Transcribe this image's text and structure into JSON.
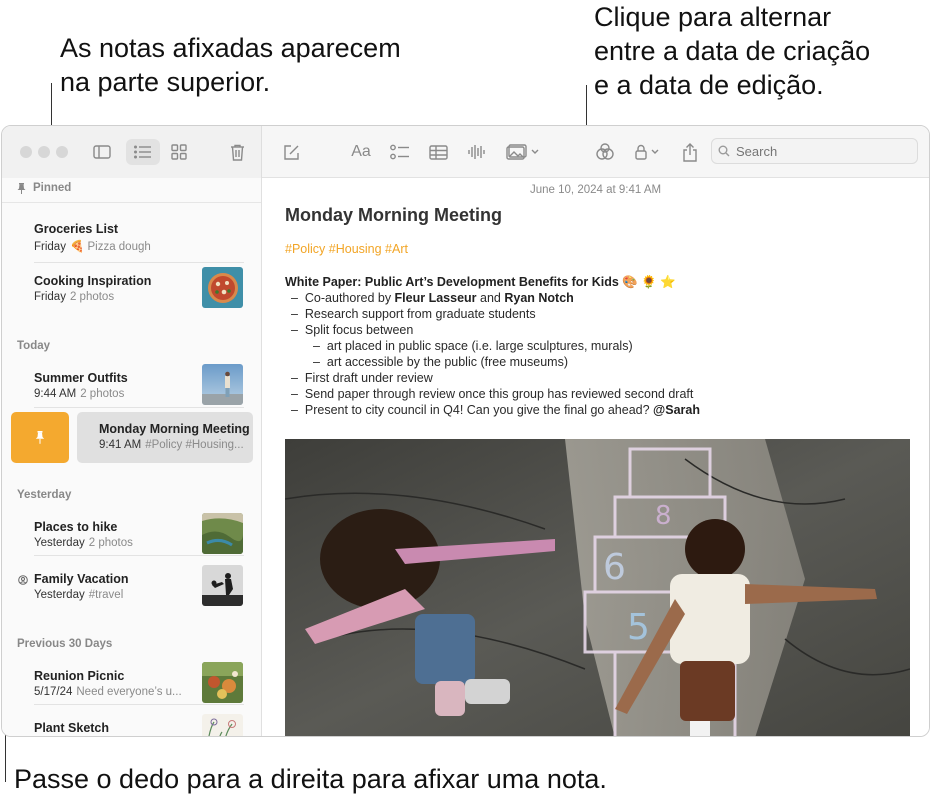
{
  "callouts": {
    "pinned_top": [
      "As notas afixadas aparecem",
      "na parte superior."
    ],
    "toggle_date": [
      "Clique para alternar",
      "entre a data de criação",
      "e a data de edição."
    ],
    "swipe_pin": "Passe o dedo para a direita para afixar uma nota."
  },
  "toolbar": {
    "format_label": "Aa",
    "search_placeholder": "Search"
  },
  "sidebar": {
    "sections": {
      "pinned": "Pinned",
      "today": "Today",
      "yesterday": "Yesterday",
      "previous": "Previous 30 Days"
    },
    "notes": [
      {
        "title": "Groceries List",
        "date": "Friday",
        "preview": "🍕 Pizza dough"
      },
      {
        "title": "Cooking Inspiration",
        "date": "Friday",
        "preview": "2 photos"
      },
      {
        "title": "Summer Outfits",
        "date": "9:44 AM",
        "preview": "2 photos"
      },
      {
        "title": "Monday Morning Meeting",
        "date": "9:41 AM",
        "preview": "#Policy #Housing..."
      },
      {
        "title": "Places to hike",
        "date": "Yesterday",
        "preview": "2 photos"
      },
      {
        "title": "Family Vacation",
        "date": "Yesterday",
        "preview": "#travel"
      },
      {
        "title": "Reunion Picnic",
        "date": "5/17/24",
        "preview": "Need everyone’s u..."
      },
      {
        "title": "Plant Sketch",
        "date": "",
        "preview": ""
      }
    ]
  },
  "note": {
    "date": "June 10, 2024 at 9:41 AM",
    "title": "Monday Morning Meeting",
    "tags": "#Policy #Housing #Art",
    "heading": "White Paper: Public Art’s Development Benefits for Kids 🎨 🌻 ⭐",
    "bullets": {
      "b1_prefix": "Co-authored by ",
      "b1_name1": "Fleur Lasseur",
      "b1_and": " and ",
      "b1_name2": "Ryan Notch",
      "b2": "Research support from graduate students",
      "b3": "Split focus between",
      "b3a": "art placed in public space (i.e. large sculptures, murals)",
      "b3b": "art accessible by the public (free museums)",
      "b4": "First draft under review",
      "b5": "Send paper through review once this group has reviewed second draft",
      "b6_prefix": "Present to city council in Q4! Can you give the final go ahead? ",
      "b6_mention": "@Sarah"
    },
    "dash": "–"
  },
  "colors": {
    "accent": "#f4a92f",
    "tag": "#f2a526"
  }
}
